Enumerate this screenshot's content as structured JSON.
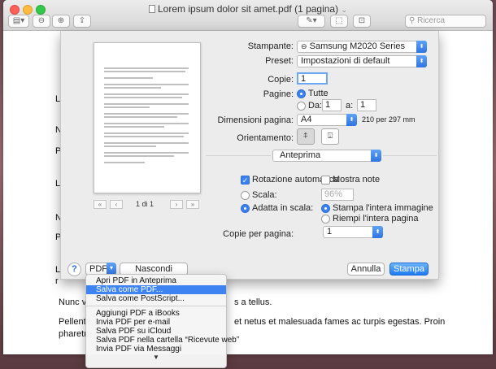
{
  "window": {
    "title": "Lorem ipsum dolor sit amet.pdf (1 pagina)",
    "title_suffix": "⌄"
  },
  "toolbar": {
    "search_placeholder": "Ricerca"
  },
  "background_text": {
    "letters": [
      "L",
      "N",
      "P",
      "L",
      "N",
      "P",
      "L",
      "r"
    ],
    "line1": "Nunc viv",
    "line1_end": "s a tellus.",
    "line2": "Pellente",
    "line2_end": "et netus et malesuada fames ac turpis egestas. Proin",
    "line3": "pharetra"
  },
  "preview": {
    "page_indicator": "1 di 1"
  },
  "print": {
    "printer_label": "Stampante:",
    "printer_value": "Samsung M2020 Series",
    "preset_label": "Preset:",
    "preset_value": "Impostazioni di default",
    "copies_label": "Copie:",
    "copies_value": "1",
    "pages_label": "Pagine:",
    "pages_all": "Tutte",
    "pages_from": "Da:",
    "pages_from_value": "1",
    "pages_to": "a:",
    "pages_to_value": "1",
    "paper_label": "Dimensioni pagina:",
    "paper_value": "A4",
    "paper_size": "210 per 297 mm",
    "orientation_label": "Orientamento:",
    "section_value": "Anteprima",
    "auto_rotate": "Rotazione automatica",
    "show_notes": "Mostra note",
    "scale_label": "Scala:",
    "scale_value": "96%",
    "fit_label": "Adatta in scala:",
    "fit_print_entire": "Stampa l'intera immagine",
    "fit_fill_page": "Riempi l'intera pagina",
    "per_page_label": "Copie per pagina:",
    "per_page_value": "1"
  },
  "footer": {
    "help": "?",
    "pdf_button": "PDF",
    "hide_details": "Nascondi dettagli",
    "cancel": "Annulla",
    "print": "Stampa"
  },
  "pdf_menu": {
    "items_top": [
      "Apri PDF in Anteprima",
      "Salva come PDF...",
      "Salva come PostScript..."
    ],
    "items_bottom": [
      "Aggiungi PDF a iBooks",
      "Invia PDF per e-mail",
      "Salva PDF su iCloud",
      "Salva PDF nella cartella “Ricevute web”",
      "Invia PDF via Messaggi"
    ],
    "highlighted_index": 1
  }
}
